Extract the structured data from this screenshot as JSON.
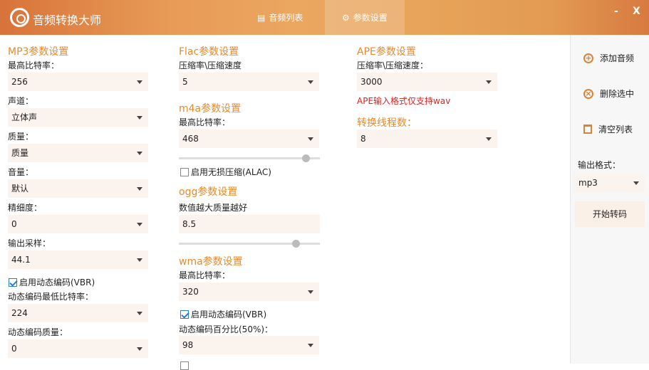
{
  "app": {
    "title": "音频转换大师"
  },
  "tabs": [
    {
      "label": "音频列表"
    },
    {
      "label": "参数设置"
    }
  ],
  "window": {
    "minimize": "-",
    "close": "X"
  },
  "mp3": {
    "title": "MP3参数设置",
    "bitrate_label": "最高比特率：",
    "bitrate": "256",
    "channel_label": "声道：",
    "channel": "立体声",
    "quality_label": "质量：",
    "quality": "质量",
    "volume_label": "音量：",
    "volume": "默认",
    "precision_label": "精细度：",
    "precision": "0",
    "sample_label": "输出采样：",
    "sample": "44.1",
    "vbr_label": "启用动态编码(VBR)",
    "vbr_checked": true,
    "vbr_min_label": "动态编码最低比特率：",
    "vbr_min": "224",
    "vbr_quality_label": "动态编码质量：",
    "vbr_quality": "0"
  },
  "flac": {
    "title": "Flac参数设置",
    "label": "压缩率\\压缩速度",
    "value": "5"
  },
  "m4a": {
    "title": "m4a参数设置",
    "bitrate_label": "最高比特率：",
    "bitrate": "468",
    "slider_fraction": 0.9,
    "alac_label": "启用无损压缩(ALAC)",
    "alac_checked": false
  },
  "ogg": {
    "title": "ogg参数设置",
    "label": "数值越大质量越好",
    "value": "8.5",
    "slider_fraction": 0.83
  },
  "wma": {
    "title": "wma参数设置",
    "bitrate_label": "最高比特率：",
    "bitrate": "320",
    "vbr_label": "启用动态编码(VBR)",
    "vbr_checked": true,
    "vbr_pct_label": "动态编码百分比(50%)：",
    "vbr_pct": "98"
  },
  "ape": {
    "title": "APE参数设置",
    "label": "压缩率\\压缩速度：",
    "value": "3000",
    "note": "APE输入格式仅支持wav"
  },
  "threads": {
    "title": "转换线程数：",
    "value": "8"
  },
  "sidebar": {
    "add": "添加音频",
    "remove": "删除选中",
    "clear": "清空列表",
    "format_label": "输出格式：",
    "format": "mp3",
    "start": "开始转码"
  },
  "colors": {
    "accent": "#e8892b",
    "note": "#e0201e",
    "select_bg": "#fbf3ee"
  }
}
